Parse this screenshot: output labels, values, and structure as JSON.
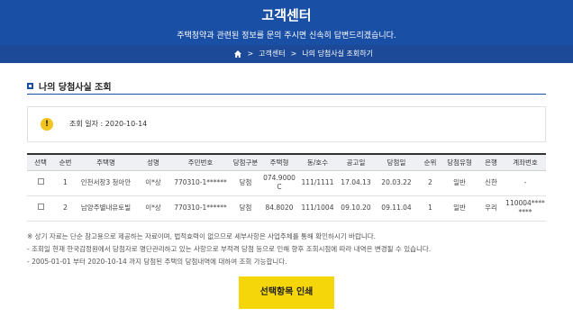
{
  "banner": {
    "title": "고객센터",
    "subtitle": "주택청약과 관련된 정보를 문의 주시면 신속히 답변드리겠습니다."
  },
  "breadcrumb": {
    "home_icon": "home-icon",
    "items": [
      "고객센터",
      "나의 당첨사실 조회하기"
    ]
  },
  "section": {
    "title": "나의 당첨사실 조회"
  },
  "info": {
    "date_text": "조회 일자 : 2020-10-14"
  },
  "table": {
    "headers": [
      "선택",
      "순번",
      "주택명",
      "성명",
      "주민번호",
      "당첨구분",
      "주택형",
      "동/호수",
      "공고일",
      "당첨일",
      "순위",
      "당첨유형",
      "은행",
      "계좌번호"
    ],
    "rows": [
      [
        "",
        "1",
        "인천서창3 청아안",
        "이*상",
        "770310-1******",
        "당첨",
        "074.9000C",
        "111/1111",
        "17.04.13",
        "20.03.22",
        "2",
        "일반",
        "신한",
        "-"
      ],
      [
        "",
        "2",
        "남양주별내유토빌",
        "이*상",
        "770310-1******",
        "당첨",
        "84.8020",
        "111/1004",
        "09.10.20",
        "09.11.04",
        "1",
        "일반",
        "우리",
        "110004********"
      ]
    ]
  },
  "notes": [
    "※ 상기 자료는 단순 참고용으로 제공하는 자료이며, 법적효력이 없으므로 세부사항은 사업주체를 통해 확인하시기 바랍니다.",
    "- 조회일 현재 한국감정원에서 당첨자로 명단관리하고 있는 사항으로 부적격 당첨 등으로 인해 향후 조회시점에 따라 내역은 변경될 수 있습니다.",
    "- 2005-01-01 부터 2020-10-14 까지 당첨된 주택의 당첨내역에 대하여 조회 가능합니다."
  ],
  "print_button": {
    "label": "선택항목 인쇄"
  },
  "colors": {
    "banner": "#1a4fa6",
    "button": "#f5d60a",
    "warning": "#f3c41b"
  }
}
